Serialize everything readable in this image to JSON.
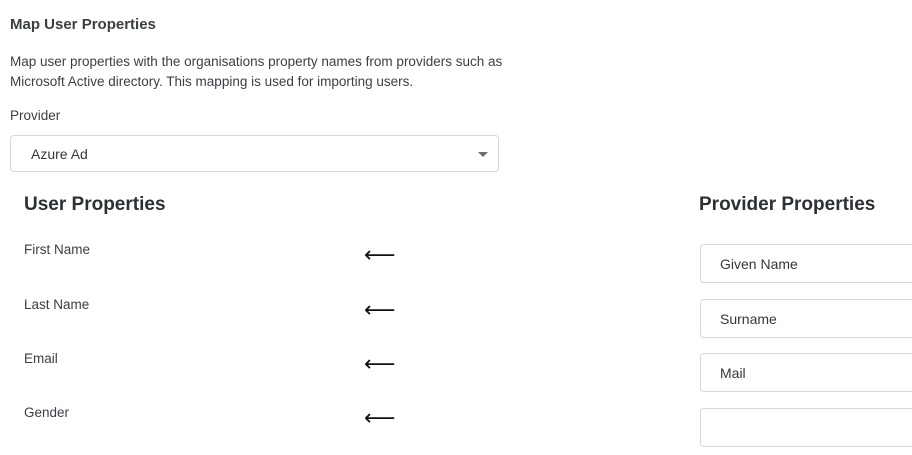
{
  "page": {
    "title": "Map User Properties",
    "description": "Map user properties with the organisations property names from providers such as Microsoft Active directory. This mapping is used for importing users."
  },
  "provider": {
    "label": "Provider",
    "selected": "Azure Ad"
  },
  "sections": {
    "user_heading": "User Properties",
    "provider_heading": "Provider Properties"
  },
  "mappings": [
    {
      "user_property": "First Name",
      "provider_property": "Given Name"
    },
    {
      "user_property": "Last Name",
      "provider_property": "Surname"
    },
    {
      "user_property": "Email",
      "provider_property": "Mail"
    },
    {
      "user_property": "Gender",
      "provider_property": ""
    }
  ],
  "icons": {
    "mapping_arrow": "left-arrow-icon",
    "dropdown": "chevron-down-icon"
  }
}
